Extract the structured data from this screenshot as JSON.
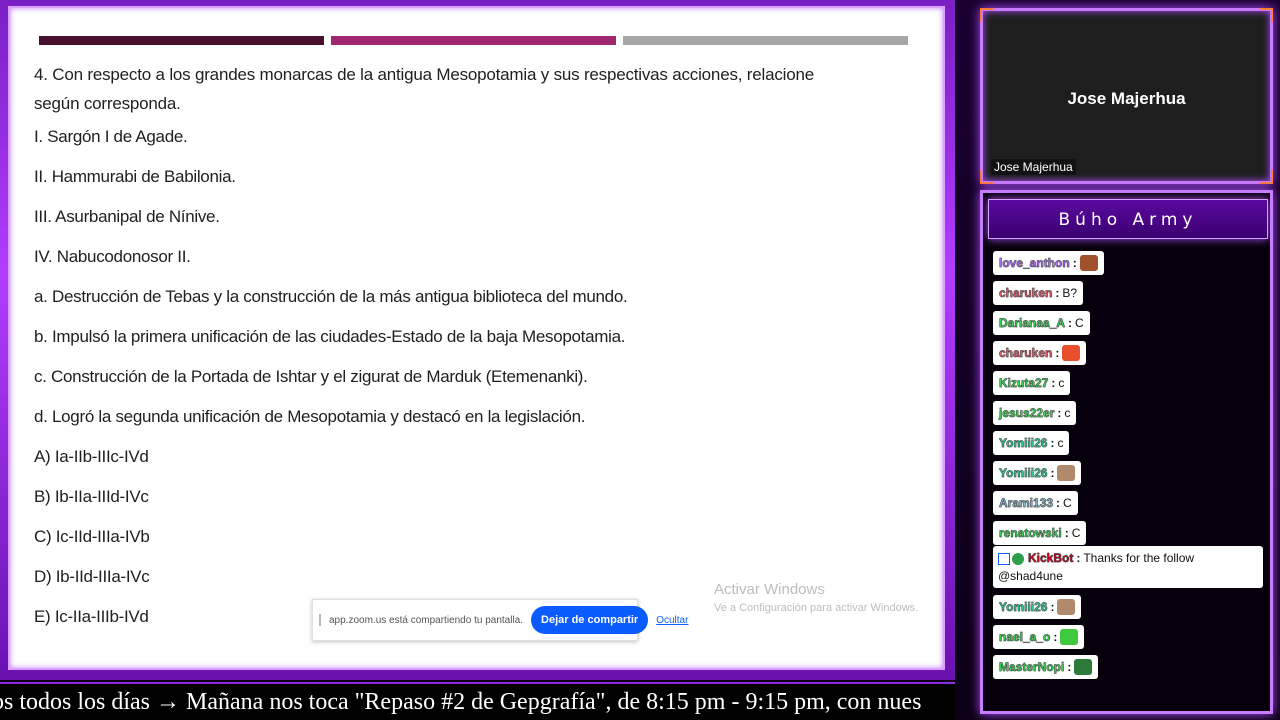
{
  "question": {
    "stem": "4. Con respecto a los grandes monarcas de la antigua Mesopotamia y sus respectivas acciones, relacione según corresponda.",
    "items": [
      "I. Sargón I de Agade.",
      "II. Hammurabi de Babilonia.",
      "III. Asurbanipal de Nínive.",
      "IV. Nabucodonosor II.",
      "a. Destrucción de Tebas y la construcción de la más antigua biblioteca del mundo.",
      "b. Impulsó la primera unificación de las ciudades-Estado de la baja Mesopotamia.",
      "c. Construcción de la Portada de Ishtar y el zigurat de Marduk (Etemenanki).",
      "d. Logró la segunda unificación de Mesopotamia y destacó en la legislación."
    ],
    "options": [
      "A) Ia-IIb-IIIc-IVd",
      "B) Ib-IIa-IIId-IVc",
      "C) Ic-IId-IIIa-IVb",
      "D) Ib-IId-IIIa-IVc",
      "E) Ic-IIa-IIIb-IVd"
    ]
  },
  "watermark": {
    "line1": "Activar Windows",
    "line2": "Ve a Configuración para activar Windows."
  },
  "zoom": {
    "message": "app.zoom.us está compartiendo tu pantalla.",
    "stop_label": "Dejar de compartir",
    "hide_label": "Ocultar"
  },
  "ticker": "os todos los días  →  Mañana nos toca \"Repaso #2 de Gepgrafía\", de 8:15 pm - 9:15 pm, con nues",
  "camera": {
    "name": "Jose Majerhua",
    "label": "Jose Majerhua"
  },
  "chat": {
    "title": "Búho Army",
    "messages": [
      {
        "user": "love_anthon",
        "text": "",
        "emote": "bear-emote",
        "color": "#b46cff"
      },
      {
        "user": "charuken",
        "text": "B?",
        "emote": "",
        "color": "#e05a6a"
      },
      {
        "user": "Darianaa_A",
        "text": "C",
        "emote": "",
        "color": "#39d353"
      },
      {
        "user": "charuken",
        "text": "",
        "emote": "crab-emote",
        "color": "#e05a6a"
      },
      {
        "user": "Kizuta27",
        "text": "c",
        "emote": "",
        "color": "#39d353"
      },
      {
        "user": "jesus22er",
        "text": "c",
        "emote": "",
        "color": "#39d353"
      },
      {
        "user": "Yomiii26",
        "text": "c",
        "emote": "",
        "color": "#2ecc9a"
      },
      {
        "user": "Yomiii26",
        "text": "",
        "emote": "cat-emote",
        "color": "#2ecc9a"
      },
      {
        "user": "Arami133",
        "text": "C",
        "emote": "",
        "color": "#7fb3c8"
      },
      {
        "user": "renatowski",
        "text": "C",
        "emote": "",
        "color": "#39d353"
      }
    ],
    "kickbot": {
      "user": "KickBot",
      "text": "Thanks for the follow",
      "text2": "@shad4une",
      "color": "#d0021b"
    },
    "messages_after": [
      {
        "user": "Yomiii26",
        "text": "",
        "emote": "cat-emote",
        "color": "#2ecc9a"
      },
      {
        "user": "nael_a_o",
        "text": "",
        "emote": "smile-emote",
        "color": "#39d353"
      },
      {
        "user": "MasterNopi",
        "text": "",
        "emote": "car-emote",
        "color": "#39d353"
      }
    ]
  }
}
